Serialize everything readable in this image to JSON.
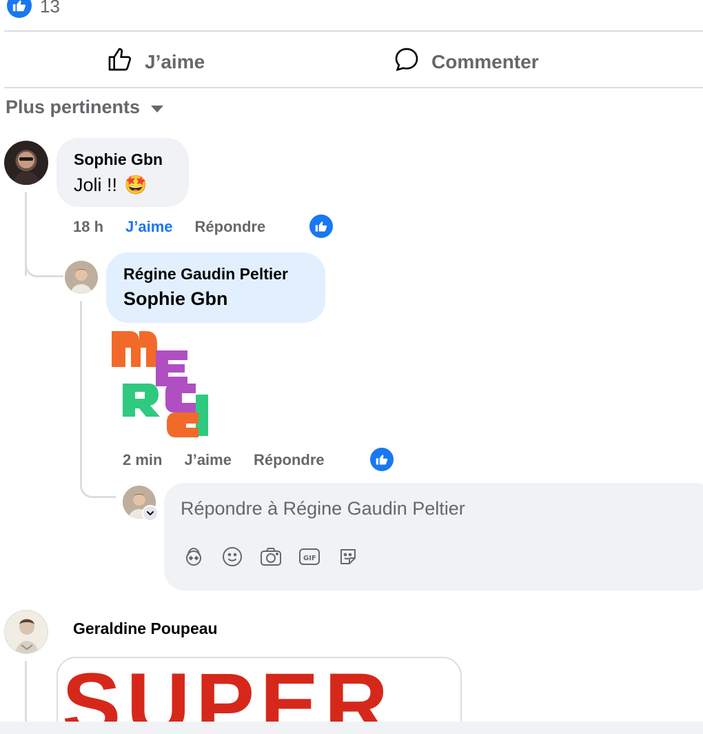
{
  "post": {
    "reaction_count": "13",
    "actions": {
      "like_label": "J’aime",
      "comment_label": "Commenter"
    }
  },
  "comments_sort": {
    "label": "Plus pertinents"
  },
  "comments": [
    {
      "author": "Sophie Gbn",
      "text": "Joli !!",
      "emoji": "🤩",
      "time": "18 h",
      "like_label": "J’aime",
      "reply_label": "Répondre"
    },
    {
      "author": "Régine Gaudin Peltier",
      "mention": "Sophie Gbn",
      "sticker_text": "MERCI",
      "time": "2 min",
      "like_label": "J’aime",
      "reply_label": "Répondre"
    },
    {
      "author": "Geraldine Poupeau",
      "sticker_text": "SUPER"
    }
  ],
  "reply_box": {
    "placeholder": "Répondre à Régine Gaudin Peltier",
    "tools": [
      "avatar-sticker-icon",
      "emoji-icon",
      "camera-icon",
      "gif-icon",
      "sticker-icon"
    ]
  },
  "colors": {
    "accent": "#1877f2",
    "muted": "#65676b",
    "bubble": "#f0f2f5",
    "bubble_highlight": "#e2efff",
    "merci_orange": "#f26a2a",
    "merci_purple": "#b04fc2",
    "merci_green": "#2fc980",
    "super_red": "#d6281a"
  }
}
